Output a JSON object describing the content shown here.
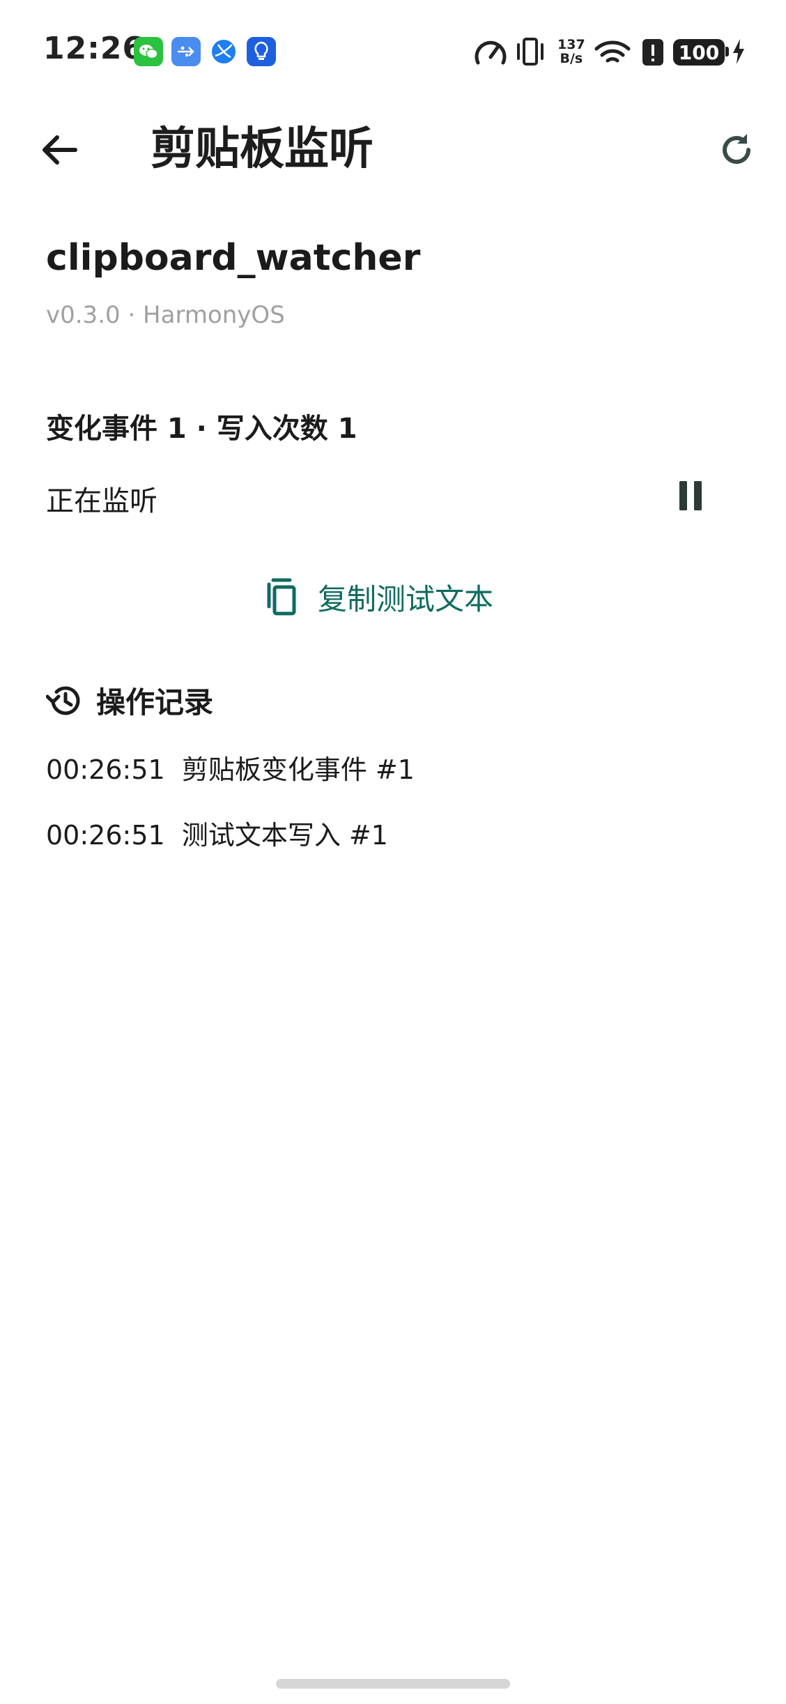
{
  "status_bar": {
    "time": "12:26",
    "apps": [
      "wechat-icon",
      "usb-icon",
      "browser-icon",
      "bulb-icon"
    ],
    "net_speed_value": "137",
    "net_speed_unit": "B/s",
    "battery": "100"
  },
  "app_bar": {
    "title": "剪贴板监听"
  },
  "plugin": {
    "name": "clipboard_watcher",
    "meta": "v0.3.0 · HarmonyOS"
  },
  "stats": {
    "text": "变化事件 1 · 写入次数 1"
  },
  "listening": {
    "label": "正在监听"
  },
  "actions": {
    "copy_label": "复制测试文本"
  },
  "log": {
    "title": "操作记录",
    "items": [
      "00:26:51  剪贴板变化事件 #1",
      "00:26:51  测试文本写入 #1"
    ]
  },
  "colors": {
    "accent": "#0f6b5f",
    "muted": "#a0a0a0",
    "text": "#1b1b1b"
  }
}
